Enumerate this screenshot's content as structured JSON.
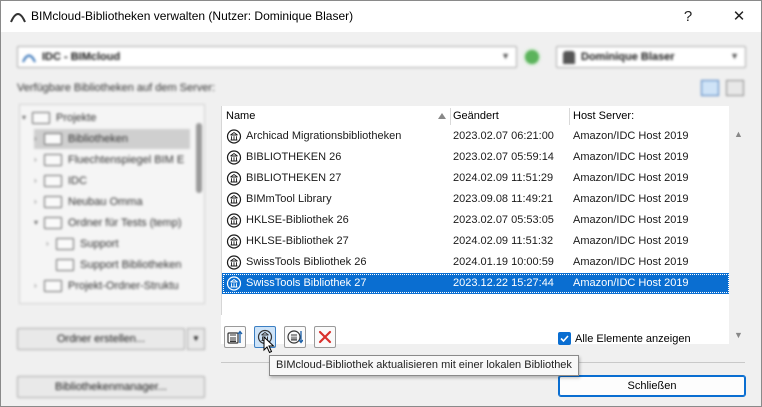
{
  "window": {
    "title": "BIMcloud-Bibliotheken verwalten (Nutzer: Dominique Blaser)",
    "help_label": "?",
    "close_label": "✕"
  },
  "top": {
    "library_source": "IDC - BIMcloud",
    "user": "Dominique Blaser",
    "available_label": "Verfügbare Bibliotheken auf dem Server:"
  },
  "tree": {
    "items": [
      {
        "label": "Projekte"
      },
      {
        "label": "Bibliotheken"
      },
      {
        "label": "Fluechtenspiegel BIM E"
      },
      {
        "label": "IDC"
      },
      {
        "label": "Neubau Omma"
      },
      {
        "label": "Ordner für Tests (temp)"
      },
      {
        "label": "Support"
      },
      {
        "label": "Support Bibliotheken"
      },
      {
        "label": "Projekt-Ordner-Struktu"
      }
    ]
  },
  "buttons": {
    "create_folder": "Ordner erstellen...",
    "library_manager": "Bibliothekenmanager...",
    "close": "Schließen"
  },
  "table": {
    "headers": {
      "name": "Name",
      "changed": "Geändert",
      "host": "Host Server:"
    },
    "rows": [
      {
        "name": "Archicad Migrationsbibliotheken",
        "changed": "2023.02.07 06:21:00",
        "host": "Amazon/IDC Host 2019"
      },
      {
        "name": "BIBLIOTHEKEN 26",
        "changed": "2023.02.07 05:59:14",
        "host": "Amazon/IDC Host 2019"
      },
      {
        "name": "BIBLIOTHEKEN 27",
        "changed": "2024.02.09 11:51:29",
        "host": "Amazon/IDC Host 2019"
      },
      {
        "name": "BIMmTool Library",
        "changed": "2023.09.08 11:49:21",
        "host": "Amazon/IDC Host 2019"
      },
      {
        "name": "HKLSE-Bibliothek 26",
        "changed": "2023.02.07 05:53:05",
        "host": "Amazon/IDC Host 2019"
      },
      {
        "name": "HKLSE-Bibliothek 27",
        "changed": "2024.02.09 11:51:32",
        "host": "Amazon/IDC Host 2019"
      },
      {
        "name": "SwissTools Bibliothek 26",
        "changed": "2024.01.19 10:00:59",
        "host": "Amazon/IDC Host 2019"
      },
      {
        "name": "SwissTools Bibliothek 27",
        "changed": "2023.12.22 15:27:44",
        "host": "Amazon/IDC Host 2019"
      }
    ]
  },
  "options": {
    "show_all_label": "Alle Elemente anzeigen",
    "show_all_checked": true
  },
  "tooltip": "BIMcloud-Bibliothek aktualisieren mit einer lokalen Bibliothek",
  "colors": {
    "accent": "#0a6ed1",
    "delete": "#d9302c"
  }
}
